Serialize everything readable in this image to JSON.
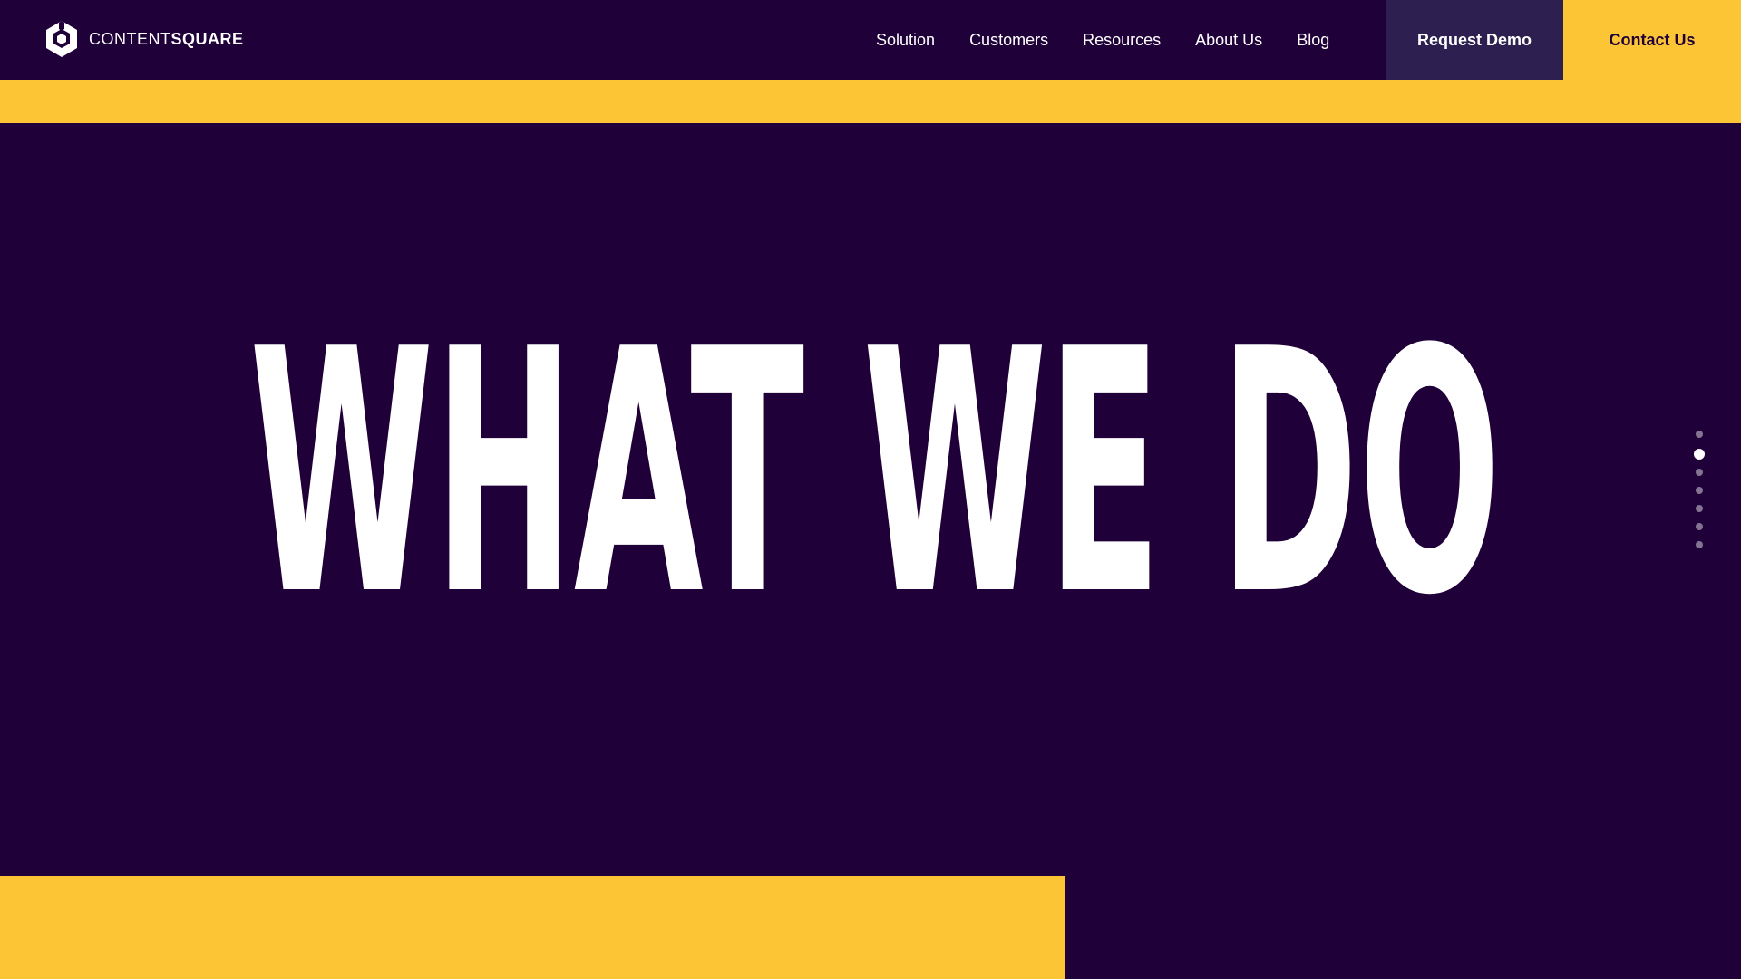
{
  "brand": {
    "name_light": "CONTENT",
    "name_bold": "SQUARE",
    "icon": "contentsquare-logo-icon"
  },
  "nav": {
    "items": [
      {
        "label": "Solution"
      },
      {
        "label": "Customers"
      },
      {
        "label": "Resources"
      },
      {
        "label": "About Us"
      },
      {
        "label": "Blog"
      }
    ]
  },
  "cta": {
    "request_demo": "Request Demo",
    "contact_us": "Contact Us"
  },
  "hero": {
    "title": "WHAT WE DO"
  },
  "pagination": {
    "total": 7,
    "active_index": 1
  },
  "colors": {
    "background": "#1f0039",
    "accent_yellow": "#fbc536",
    "demo_button": "#2d1f4f",
    "text": "#ffffff"
  }
}
